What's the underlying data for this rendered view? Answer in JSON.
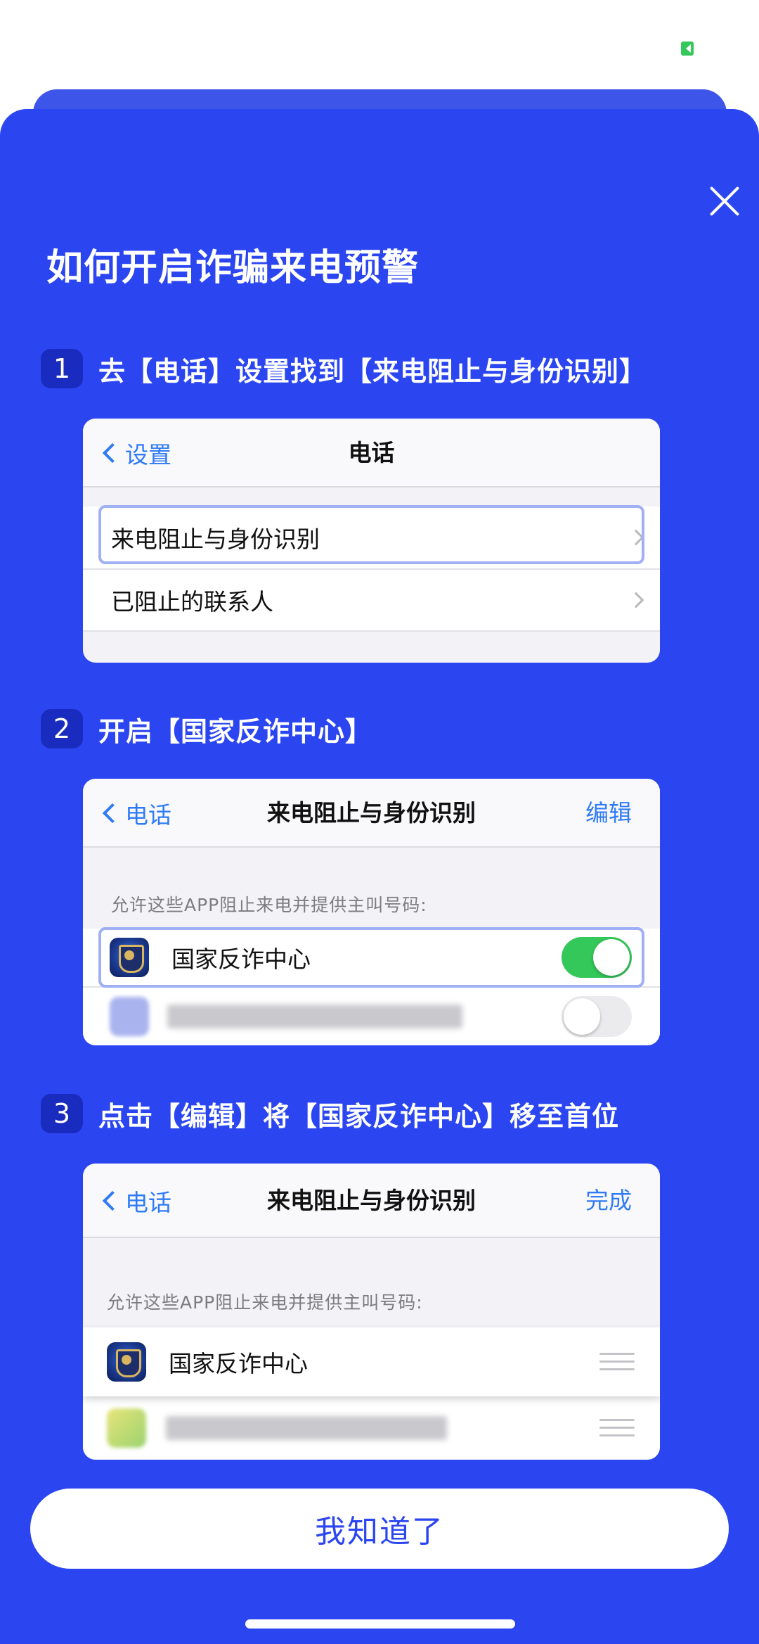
{
  "dialog": {
    "title": "如何开启诈骗来电预警",
    "confirm_button": "我知道了"
  },
  "steps": [
    {
      "number": "1",
      "text": "去【电话】设置找到【来电阻止与身份识别】",
      "card": {
        "back_label": "设置",
        "nav_title": "电话",
        "rows": [
          "来电阻止与身份识别",
          "已阻止的联系人"
        ]
      }
    },
    {
      "number": "2",
      "text": "开启【国家反诈中心】",
      "card": {
        "back_label": "电话",
        "nav_title": "来电阻止与身份识别",
        "right_action": "编辑",
        "section_caption": "允许这些APP阻止来电并提供主叫号码:",
        "app_name": "国家反诈中心",
        "app_toggle": true,
        "other_app_toggle": false
      }
    },
    {
      "number": "3",
      "text": "点击【编辑】将【国家反诈中心】移至首位",
      "card": {
        "back_label": "电话",
        "nav_title": "来电阻止与身份识别",
        "right_action": "完成",
        "section_caption": "允许这些APP阻止来电并提供主叫号码:",
        "app_name": "国家反诈中心"
      }
    }
  ],
  "colors": {
    "sheet_background": "#2b46f1",
    "ios_link_blue": "#2f7bf6",
    "toggle_on": "#34c759"
  },
  "icons": [
    "close-icon",
    "chevron-left-icon",
    "chevron-right-icon",
    "app-shield-icon",
    "drag-handle-icon"
  ]
}
